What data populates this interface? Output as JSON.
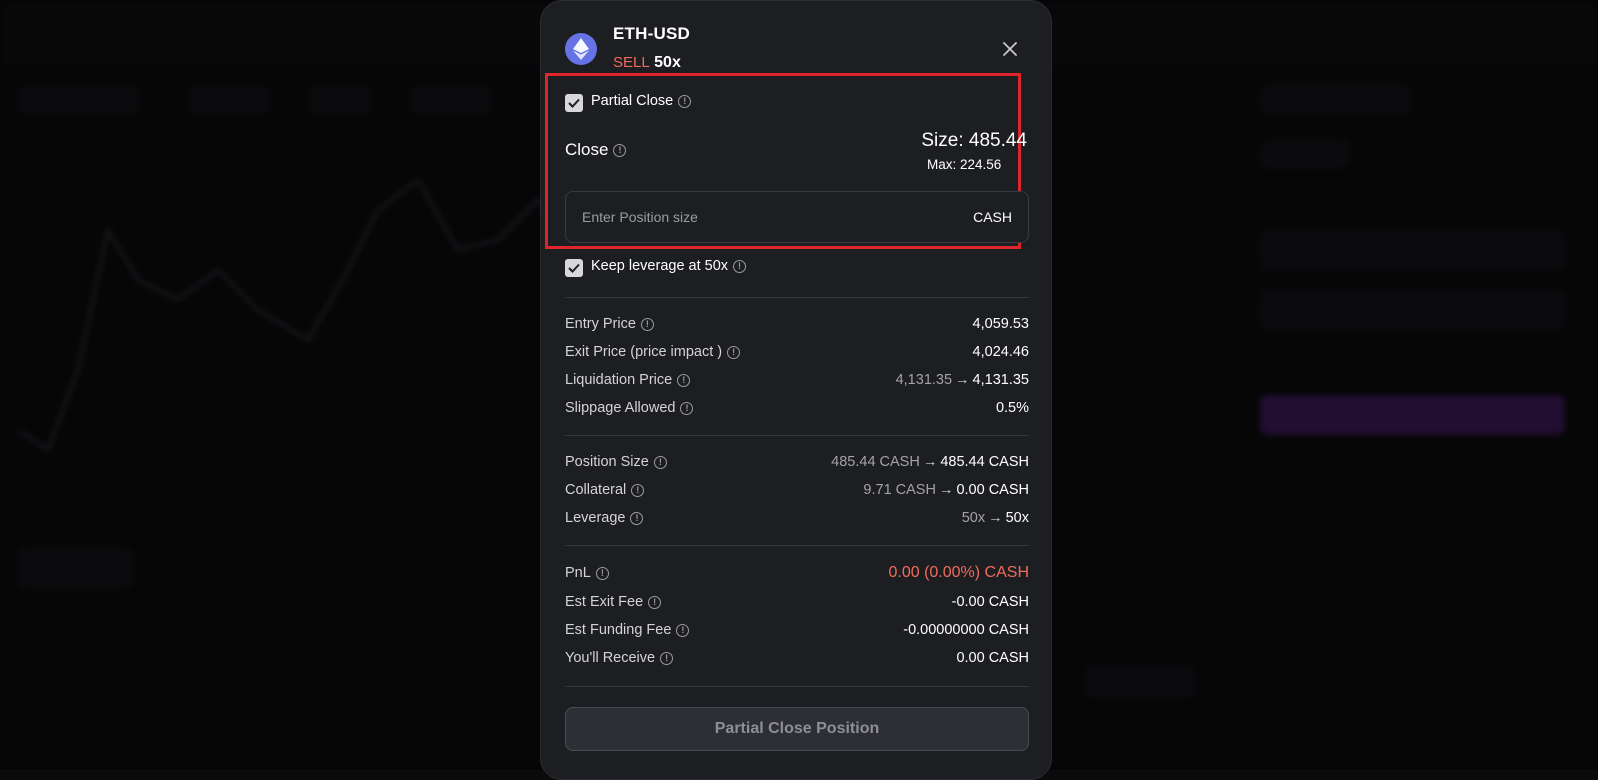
{
  "modal": {
    "pair": "ETH-USD",
    "side": "SELL",
    "leverage": "50x",
    "icon": "ethereum-icon",
    "close_icon": "close-icon"
  },
  "partial_close": {
    "label": "Partial Close",
    "checked": true
  },
  "close_section": {
    "label": "Close",
    "size": "Size: 485.44",
    "max": "Max: 224.56",
    "input_placeholder": "Enter Position size",
    "input_value": "",
    "unit": "CASH"
  },
  "keep_leverage": {
    "label": "Keep leverage at 50x",
    "checked": true
  },
  "price_info": [
    {
      "label": "Entry Price",
      "value": "4,059.53"
    },
    {
      "label": "Exit Price (price impact )",
      "value": "4,024.46"
    },
    {
      "label": "Liquidation Price",
      "from": "4,131.35",
      "to": "4,131.35"
    },
    {
      "label": "Slippage Allowed",
      "value": "0.5%"
    }
  ],
  "position_info": [
    {
      "label": "Position Size",
      "from": "485.44 CASH",
      "to": "485.44 CASH"
    },
    {
      "label": "Collateral",
      "from": "9.71 CASH",
      "to": "0.00 CASH"
    },
    {
      "label": "Leverage",
      "from": "50x",
      "to": "50x"
    }
  ],
  "pnl_info": [
    {
      "label": "PnL",
      "value": "0.00 (0.00%) CASH"
    },
    {
      "label": "Est Exit Fee",
      "value": "-0.00 CASH"
    },
    {
      "label": "Est Funding Fee",
      "value": "-0.00000000 CASH"
    },
    {
      "label": "You'll Receive",
      "value": "0.00 CASH"
    }
  ],
  "arrow": "→",
  "action_button": "Partial Close Position",
  "colors": {
    "sell": "#f06b5b",
    "highlight_border": "#e0242b",
    "eth_icon": "#6573e6"
  }
}
